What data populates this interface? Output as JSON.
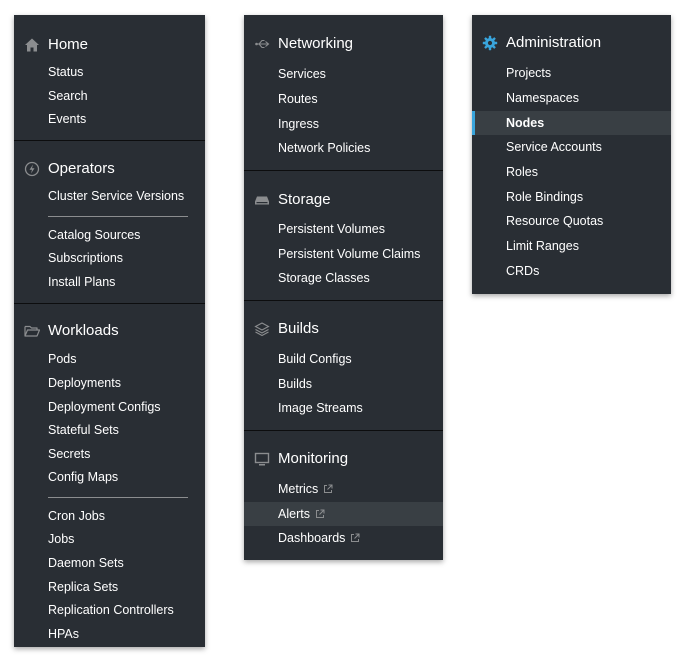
{
  "col1": {
    "home": {
      "title": "Home",
      "icon": "home-icon",
      "items": [
        "Status",
        "Search",
        "Events"
      ]
    },
    "operators": {
      "title": "Operators",
      "icon": "bolt-circle-icon",
      "items": [
        "Cluster Service Versions",
        "Catalog Sources",
        "Subscriptions",
        "Install Plans"
      ]
    },
    "workloads": {
      "title": "Workloads",
      "icon": "folder-open-icon",
      "items": [
        "Pods",
        "Deployments",
        "Deployment Configs",
        "Stateful Sets",
        "Secrets",
        "Config Maps",
        "Cron Jobs",
        "Jobs",
        "Daemon Sets",
        "Replica Sets",
        "Replication Controllers",
        "HPAs"
      ]
    }
  },
  "col2": {
    "networking": {
      "title": "Networking",
      "icon": "network-icon",
      "items": [
        "Services",
        "Routes",
        "Ingress",
        "Network Policies"
      ]
    },
    "storage": {
      "title": "Storage",
      "icon": "hard-drive-icon",
      "items": [
        "Persistent Volumes",
        "Persistent Volume Claims",
        "Storage Classes"
      ]
    },
    "builds": {
      "title": "Builds",
      "icon": "layers-icon",
      "items": [
        "Build Configs",
        "Builds",
        "Image Streams"
      ]
    },
    "monitoring": {
      "title": "Monitoring",
      "icon": "desktop-icon",
      "items": [
        "Metrics",
        "Alerts",
        "Dashboards"
      ],
      "active_item": "Alerts",
      "external_link_icon": "external-link-icon"
    }
  },
  "col3": {
    "administration": {
      "title": "Administration",
      "icon": "gear-icon",
      "icon_color": "#39a5dc",
      "items": [
        "Projects",
        "Namespaces",
        "Nodes",
        "Service Accounts",
        "Roles",
        "Role Bindings",
        "Resource Quotas",
        "Limit Ranges",
        "CRDs"
      ],
      "selected_item": "Nodes"
    }
  },
  "colors": {
    "panel_bg": "#292e34",
    "active_bg": "#393f44",
    "accent": "#39a5dc"
  }
}
